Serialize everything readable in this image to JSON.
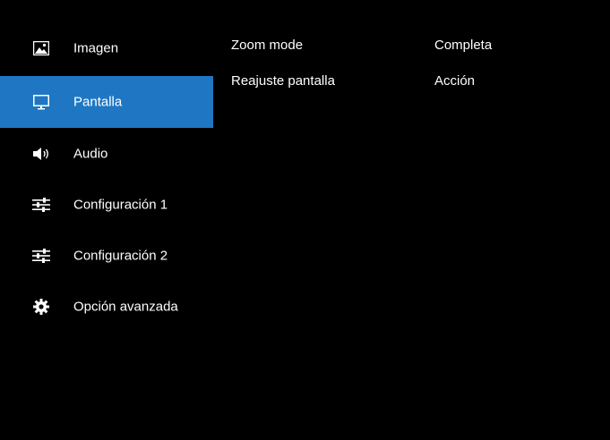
{
  "colors": {
    "background": "#000000",
    "text": "#ffffff",
    "selected_item": "#1f77c3"
  },
  "menu": {
    "items": [
      {
        "label": "Imagen",
        "icon": "picture-icon",
        "selected": false
      },
      {
        "label": "Pantalla",
        "icon": "monitor-icon",
        "selected": true
      },
      {
        "label": "Audio",
        "icon": "speaker-icon",
        "selected": false
      },
      {
        "label": "Configuración 1",
        "icon": "sliders-icon",
        "selected": false
      },
      {
        "label": "Configuración 2",
        "icon": "sliders-icon",
        "selected": false
      },
      {
        "label": "Opción avanzada",
        "icon": "gear-icon",
        "selected": false
      }
    ]
  },
  "settings": {
    "rows": [
      {
        "name": "Zoom mode",
        "value": "Completa"
      },
      {
        "name": "Reajuste pantalla",
        "value": "Acción"
      }
    ]
  }
}
